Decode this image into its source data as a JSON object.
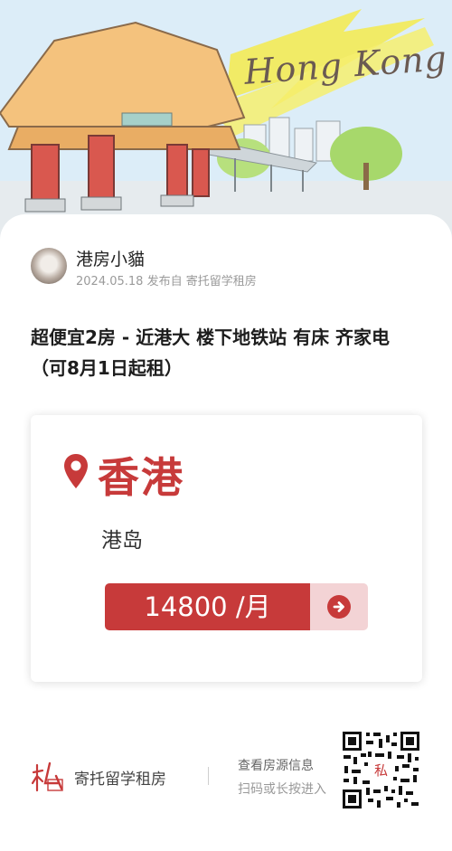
{
  "banner": {
    "city_title": "Hong Kong"
  },
  "post": {
    "author": "港房小貓",
    "meta": "2024.05.18 发布自 寄托留学租房",
    "title": "超便宜2房 - 近港大 楼下地铁站 有床 齐家电（可8月1日起租）"
  },
  "card": {
    "city": "香港",
    "district": "港岛",
    "price": "14800 /月"
  },
  "footer": {
    "brand": "寄托留学租房",
    "cta_line1": "查看房源信息",
    "cta_line2": "扫码或长按进入"
  },
  "colors": {
    "accent": "#c73a3a",
    "accent_light": "#f3d3d5"
  },
  "icons": [
    "location-pin-icon",
    "arrow-right-icon",
    "brand-logo-icon",
    "qr-code"
  ]
}
